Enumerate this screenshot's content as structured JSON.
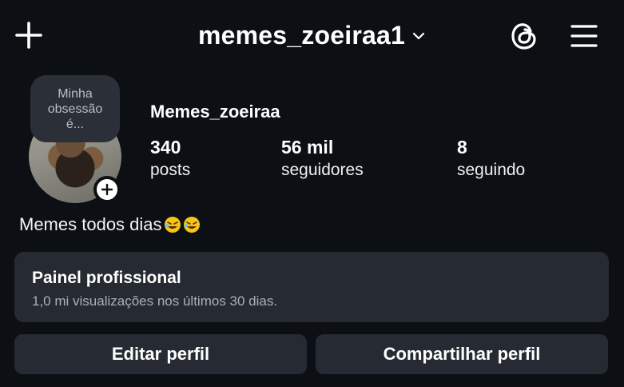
{
  "header": {
    "username": "memes_zoeiraa1",
    "icons": [
      "plus-icon",
      "chevron-down-icon",
      "threads-icon",
      "hamburger-menu-icon"
    ]
  },
  "profile": {
    "note": "Minha\nobsessão\né...",
    "display_name": "Memes_zoeiraa",
    "stats": {
      "posts": {
        "value": "340",
        "label": "posts"
      },
      "followers": {
        "value": "56 mil",
        "label": "seguidores"
      },
      "following": {
        "value": "8",
        "label": "seguindo"
      }
    },
    "bio": "Memes todos dias",
    "bio_emojis": [
      "rolling-on-floor-laughing-emoji",
      "rolling-on-floor-laughing-emoji"
    ]
  },
  "professional_panel": {
    "title": "Painel profissional",
    "subtitle": "1,0 mi visualizações nos últimos 30 dias."
  },
  "actions": {
    "edit_label": "Editar perfil",
    "share_label": "Compartilhar perfil"
  },
  "colors": {
    "background": "#0c0f14",
    "surface": "#262b33",
    "text": "#f5f5f5",
    "muted_text": "#a9b0ba"
  }
}
